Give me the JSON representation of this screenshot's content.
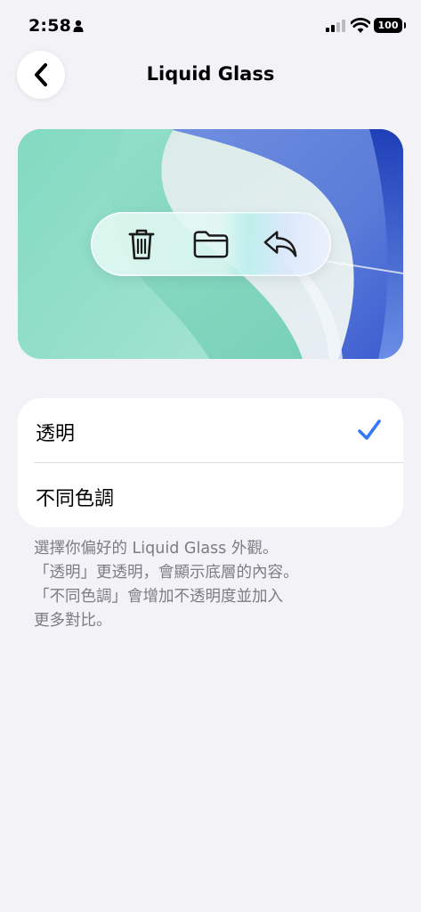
{
  "status_bar": {
    "time": "2:58",
    "battery": "100",
    "icons": [
      "person-icon",
      "cellular-signal-icon",
      "wifi-icon",
      "battery-icon"
    ]
  },
  "nav": {
    "back_icon": "chevron-left-icon",
    "title": "Liquid Glass"
  },
  "preview": {
    "toolbar_icons": [
      "trash-icon",
      "folder-icon",
      "reply-icon"
    ]
  },
  "options": [
    {
      "label": "透明",
      "selected": true
    },
    {
      "label": "不同色調",
      "selected": false
    }
  ],
  "accent_color": "#3478f6",
  "description": {
    "lines": [
      "選擇你偏好的 Liquid Glass 外觀。",
      "「透明」更透明，會顯示底層的內容。",
      "「不同色調」會增加不透明度並加入",
      "更多對比。"
    ]
  }
}
